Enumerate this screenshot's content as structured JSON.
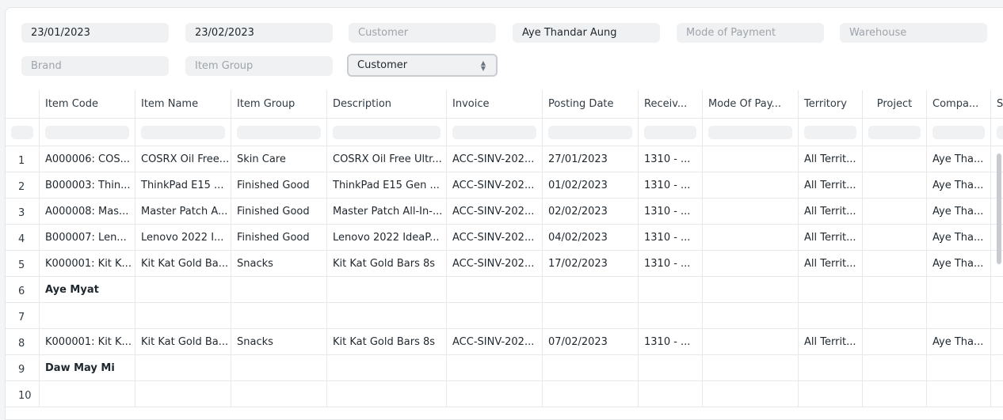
{
  "filters": {
    "from_date": "23/01/2023",
    "to_date": "23/02/2023",
    "customer_placeholder": "Customer",
    "sales_person": "Aye Thandar Aung",
    "mode_of_payment_placeholder": "Mode of Payment",
    "warehouse_placeholder": "Warehouse",
    "brand_placeholder": "Brand",
    "item_group_placeholder": "Item Group",
    "group_by": "Customer"
  },
  "table": {
    "columns": [
      "Item Code",
      "Item Name",
      "Item Group",
      "Description",
      "Invoice",
      "Posting Date",
      "Receiv...",
      "Mode Of Pay...",
      "Territory",
      "Project",
      "Compa...",
      "S"
    ],
    "rows": [
      {
        "idx": "1",
        "cells": [
          "A000006: COS...",
          "COSRX Oil Free...",
          "Skin Care",
          "COSRX Oil Free Ultr...",
          "ACC-SINV-202...",
          "27/01/2023",
          "1310 - ...",
          "",
          "All Territ...",
          "",
          "Aye Tha...",
          ""
        ]
      },
      {
        "idx": "2",
        "cells": [
          "B000003: Thin...",
          "ThinkPad E15 ...",
          "Finished Good",
          "ThinkPad E15 Gen ...",
          "ACC-SINV-202...",
          "01/02/2023",
          "1310 - ...",
          "",
          "All Territ...",
          "",
          "Aye Tha...",
          ""
        ]
      },
      {
        "idx": "3",
        "cells": [
          "A000008: Mas...",
          "Master Patch A...",
          "Finished Good",
          "Master Patch All-In-...",
          "ACC-SINV-202...",
          "02/02/2023",
          "1310 - ...",
          "",
          "All Territ...",
          "",
          "Aye Tha...",
          ""
        ]
      },
      {
        "idx": "4",
        "cells": [
          "B000007: Len...",
          "Lenovo 2022 I...",
          "Finished Good",
          "Lenovo 2022 IdeaP...",
          "ACC-SINV-202...",
          "04/02/2023",
          "1310 - ...",
          "",
          "All Territ...",
          "",
          "Aye Tha...",
          ""
        ]
      },
      {
        "idx": "5",
        "cells": [
          "K000001: Kit K...",
          "Kit Kat Gold Ba...",
          "Snacks",
          "Kit Kat Gold Bars 8s",
          "ACC-SINV-202...",
          "17/02/2023",
          "1310 - ...",
          "",
          "All Territ...",
          "",
          "Aye Tha...",
          ""
        ]
      },
      {
        "idx": "6",
        "group": true,
        "cells": [
          "Aye Myat",
          "",
          "",
          "",
          "",
          "",
          "",
          "",
          "",
          "",
          "",
          ""
        ]
      },
      {
        "idx": "7",
        "cells": [
          "",
          "",
          "",
          "",
          "",
          "",
          "",
          "",
          "",
          "",
          "",
          ""
        ]
      },
      {
        "idx": "8",
        "cells": [
          "K000001: Kit K...",
          "Kit Kat Gold Ba...",
          "Snacks",
          "Kit Kat Gold Bars 8s",
          "ACC-SINV-202...",
          "07/02/2023",
          "1310 - ...",
          "",
          "All Territ...",
          "",
          "Aye Tha...",
          ""
        ]
      },
      {
        "idx": "9",
        "group": true,
        "cells": [
          "Daw May Mi",
          "",
          "",
          "",
          "",
          "",
          "",
          "",
          "",
          "",
          "",
          ""
        ]
      },
      {
        "idx": "10",
        "cells": [
          "",
          "",
          "",
          "",
          "",
          "",
          "",
          "",
          "",
          "",
          "",
          ""
        ]
      }
    ]
  }
}
